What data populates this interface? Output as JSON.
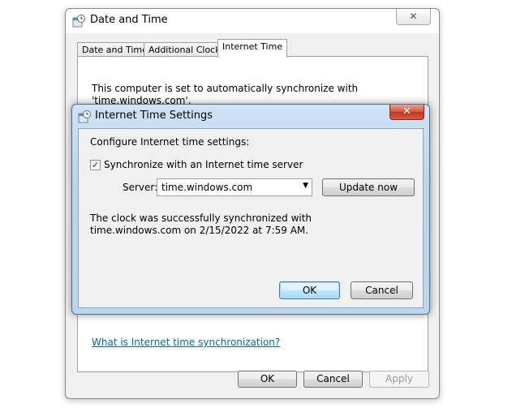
{
  "outer_window": {
    "title": "Date and Time",
    "close_glyph": "✕",
    "tabs": [
      {
        "label": "Date and Time",
        "active": false
      },
      {
        "label": "Additional Clocks",
        "active": false
      },
      {
        "label": "Internet Time",
        "active": true
      }
    ],
    "description": "This computer is set to automatically synchronize with 'time.windows.com'.",
    "help_link": "What is Internet time synchronization?",
    "buttons": {
      "ok": "OK",
      "cancel": "Cancel",
      "apply": "Apply"
    }
  },
  "dialog": {
    "title": "Internet Time Settings",
    "close_glyph": "✕",
    "configure_label": "Configure Internet time settings:",
    "sync_checkbox": {
      "label": "Synchronize with an Internet time server",
      "checked": true,
      "glyph": "✓"
    },
    "server_label": "Server:",
    "server_value": "time.windows.com",
    "dropdown_glyph": "▼",
    "update_button": "Update now",
    "status_message": "The clock was successfully synchronized with time.windows.com on 2/15/2022 at 7:59 AM.",
    "buttons": {
      "ok": "OK",
      "cancel": "Cancel"
    }
  },
  "colors": {
    "link": "#0066cc",
    "dialog_frame": "#b9d4ec",
    "close_red": "#c2361f"
  }
}
